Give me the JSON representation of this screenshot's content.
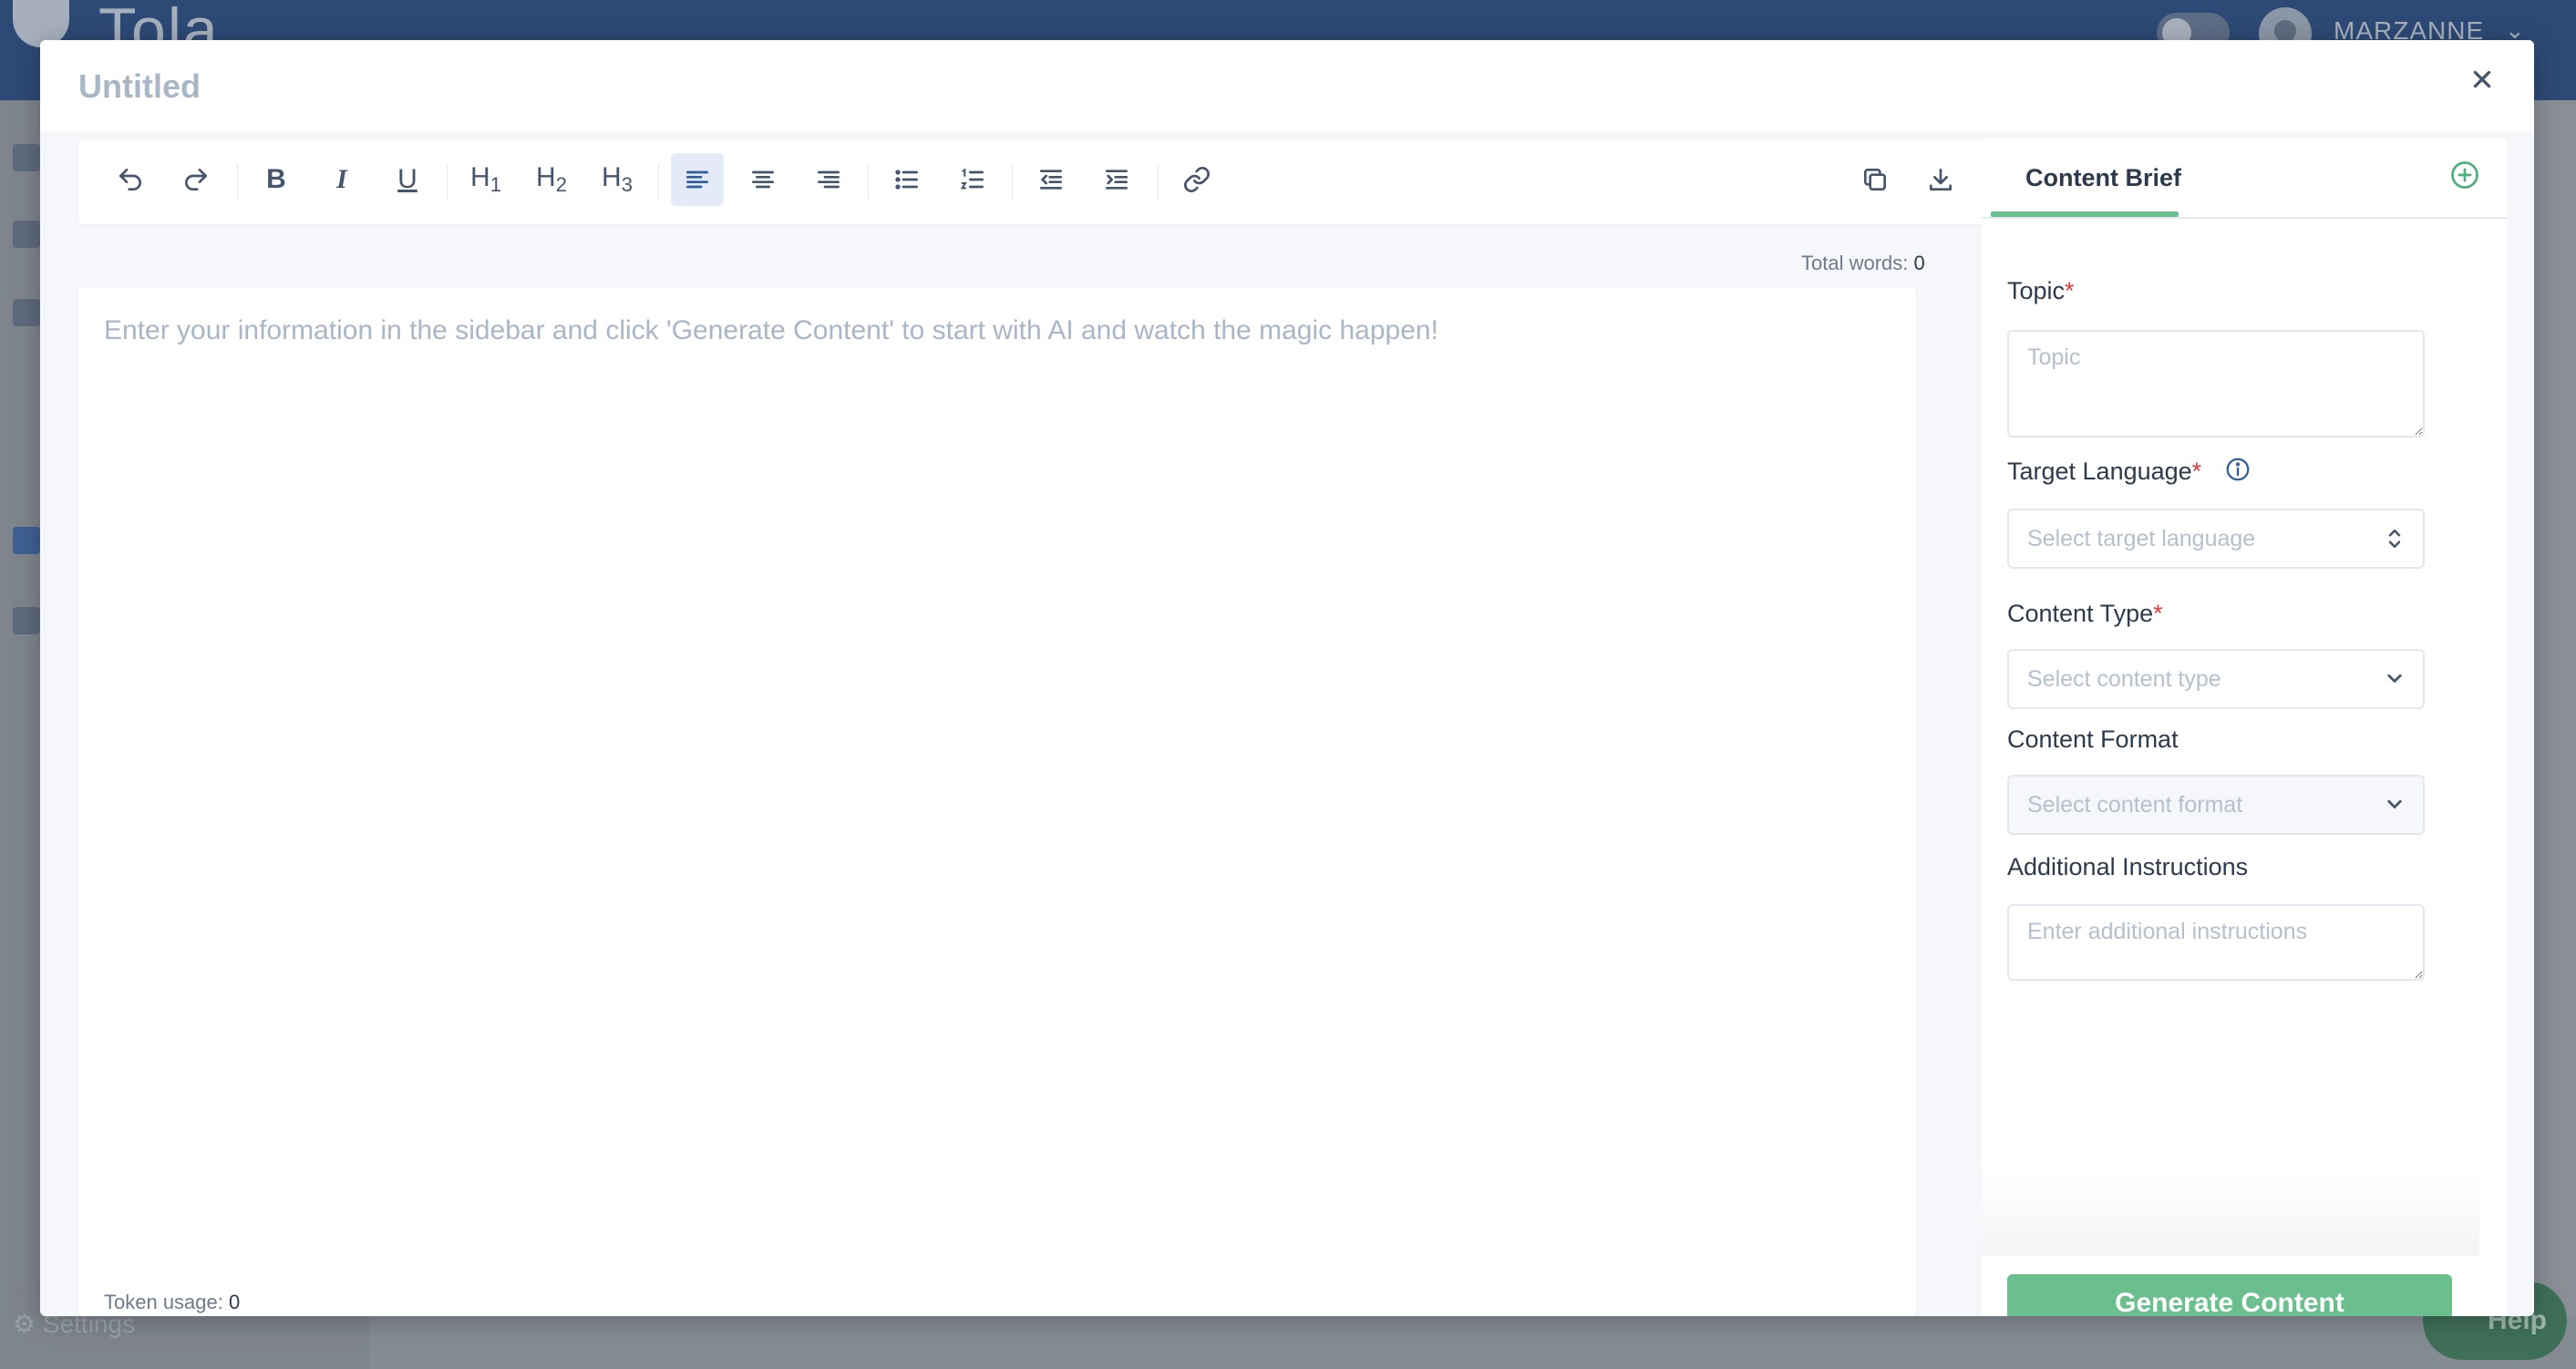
{
  "background": {
    "logo_text": "Tola",
    "user_name": "MARZANNE",
    "sidebar_settings": "Settings",
    "help_label": "Help"
  },
  "modal": {
    "title": "Untitled",
    "close_label": "×"
  },
  "toolbar": {
    "undo_icon": "undo-icon",
    "redo_icon": "redo-icon",
    "bold_label": "B",
    "italic_label": "I",
    "underline_label": "U",
    "h1_label": "H",
    "h1_sub": "1",
    "h2_label": "H",
    "h2_sub": "2",
    "h3_label": "H",
    "h3_sub": "3",
    "active_alignment": "left"
  },
  "editor": {
    "total_words_label": "Total words:",
    "total_words_value": "0",
    "placeholder": "Enter your information in the sidebar and click 'Generate Content' to start with AI and watch the magic happen!",
    "token_usage_label": "Token usage:",
    "token_usage_value": "0"
  },
  "panel": {
    "tab_label": "Content Brief",
    "topic_label": "Topic",
    "topic_placeholder": "Topic",
    "target_language_label": "Target Language",
    "target_language_placeholder": "Select target language",
    "content_type_label": "Content Type",
    "content_type_placeholder": "Select content type",
    "content_format_label": "Content Format",
    "content_format_placeholder": "Select content format",
    "additional_label": "Additional Instructions",
    "additional_placeholder": "Enter additional instructions",
    "required_mark": "*",
    "generate_button": "Generate Content"
  },
  "colors": {
    "accent_green": "#6bbf8e",
    "header_blue": "#2d4a76",
    "active_blue": "#2f5d9c",
    "required_red": "#e03a3a"
  }
}
